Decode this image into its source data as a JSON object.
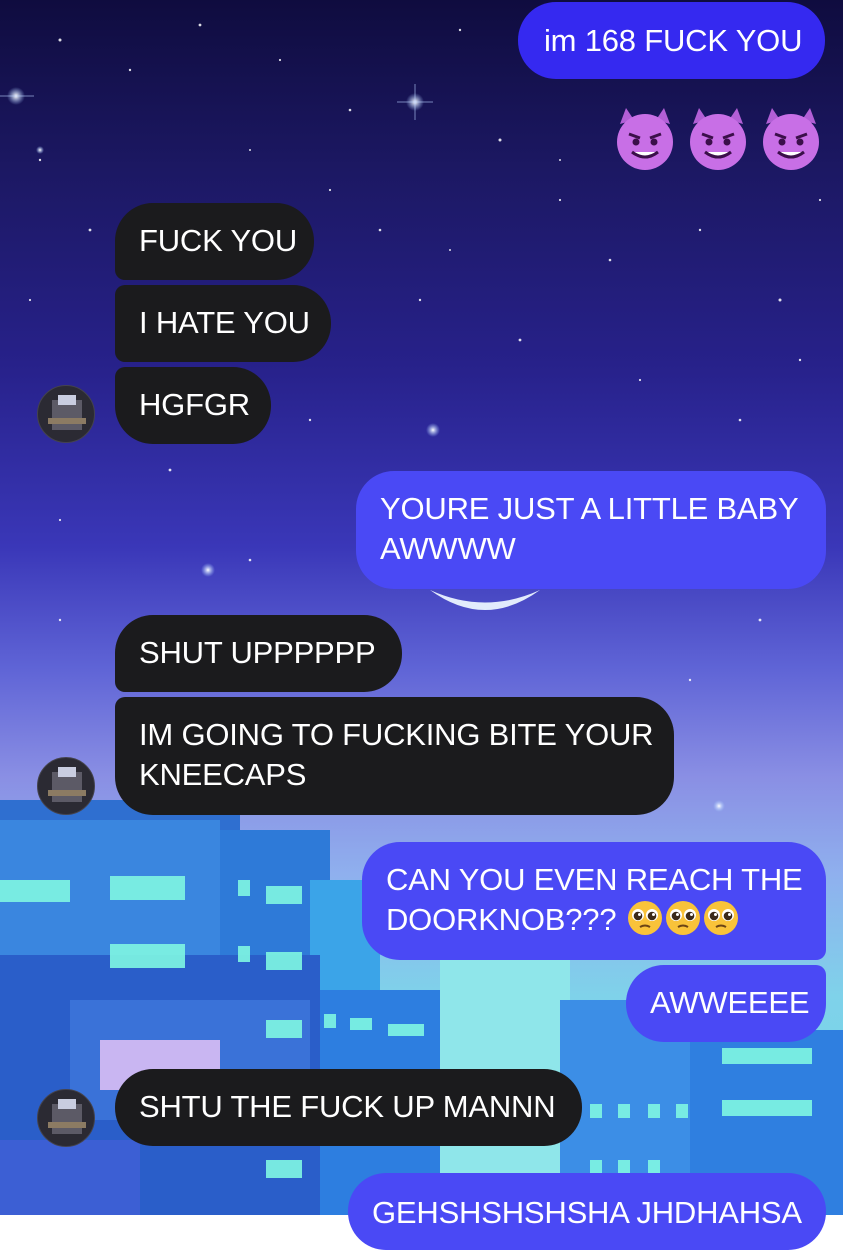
{
  "messages": [
    {
      "side": "out",
      "text": "im 168 FUCK YOU"
    },
    {
      "side": "out",
      "emoji": [
        "smiling-imp-icon",
        "smiling-imp-icon",
        "smiling-imp-icon"
      ]
    },
    {
      "side": "in",
      "text": "FUCK YOU"
    },
    {
      "side": "in",
      "text": "I HATE YOU"
    },
    {
      "side": "in",
      "text": "HGFGR"
    },
    {
      "side": "out",
      "line1": "YOURE JUST A LITTLE BABY",
      "line2": "AWWWW"
    },
    {
      "side": "in",
      "text": "SHUT UPPPPPP"
    },
    {
      "side": "in",
      "line1": "IM GOING TO FUCKING BITE YOUR",
      "line2": "KNEECAPS"
    },
    {
      "side": "out",
      "line1": "CAN YOU EVEN REACH THE",
      "line2": "DOORKNOB???",
      "emoji": [
        "pleading-face-icon",
        "pleading-face-icon",
        "pleading-face-icon"
      ]
    },
    {
      "side": "out",
      "text": "AWWEEEE"
    },
    {
      "side": "in",
      "text": "SHTU THE FUCK UP MANNN"
    },
    {
      "side": "out",
      "text": "GEHSHSHSHSHA JHDHAHSA"
    }
  ],
  "colors": {
    "incoming_bubble": "#1b1b1d",
    "outgoing_bubble": "#4a49f5",
    "outgoing_bubble_dark": "#3529f0",
    "text": "#ffffff"
  }
}
